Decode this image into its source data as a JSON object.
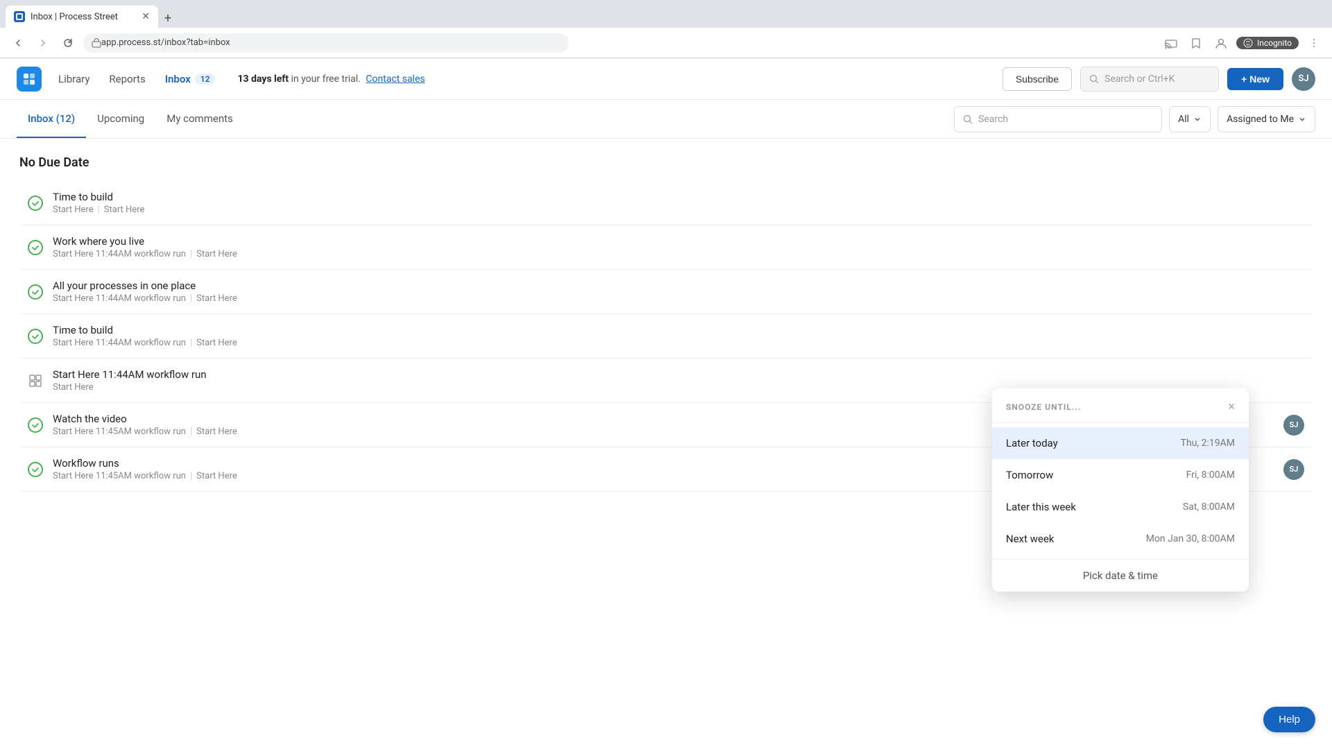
{
  "browser": {
    "tab_title": "Inbox | Process Street",
    "url": "app.process.st/inbox?tab=inbox",
    "new_tab_label": "+",
    "incognito_label": "Incognito"
  },
  "nav": {
    "library_label": "Library",
    "reports_label": "Reports",
    "inbox_label": "Inbox",
    "inbox_count": "12",
    "trial_text_bold": "13 days left",
    "trial_text_normal": " in your free trial.",
    "contact_sales_label": "Contact sales",
    "subscribe_label": "Subscribe",
    "search_placeholder": "Search or Ctrl+K",
    "new_label": "+ New",
    "avatar_initials": "SJ"
  },
  "sub_nav": {
    "tab_inbox_label": "Inbox (12)",
    "tab_upcoming_label": "Upcoming",
    "tab_comments_label": "My comments",
    "search_placeholder": "Search",
    "filter_label": "All",
    "assigned_label": "Assigned to Me"
  },
  "main": {
    "section_title": "No Due Date",
    "items": [
      {
        "title": "Time to build",
        "subtitle_part1": "Start Here",
        "subtitle_sep": "|",
        "subtitle_part2": "Start Here",
        "type": "check",
        "has_avatar": false
      },
      {
        "title": "Work where you live",
        "subtitle_part1": "Start Here 11:44AM workflow run",
        "subtitle_sep": "|",
        "subtitle_part2": "Start Here",
        "type": "check",
        "has_avatar": false
      },
      {
        "title": "All your processes in one place",
        "subtitle_part1": "Start Here 11:44AM workflow run",
        "subtitle_sep": "|",
        "subtitle_part2": "Start Here",
        "type": "check",
        "has_avatar": false
      },
      {
        "title": "Time to build",
        "subtitle_part1": "Start Here 11:44AM workflow run",
        "subtitle_sep": "|",
        "subtitle_part2": "Start Here",
        "type": "check",
        "has_avatar": false
      },
      {
        "title": "Start Here 11:44AM workflow run",
        "subtitle_part1": "Start Here",
        "subtitle_sep": "",
        "subtitle_part2": "",
        "type": "grid",
        "has_avatar": false
      },
      {
        "title": "Watch the video",
        "subtitle_part1": "Start Here 11:45AM workflow run",
        "subtitle_sep": "|",
        "subtitle_part2": "Start Here",
        "type": "check",
        "has_avatar": true
      },
      {
        "title": "Workflow runs",
        "subtitle_part1": "Start Here 11:45AM workflow run",
        "subtitle_sep": "|",
        "subtitle_part2": "Start Here",
        "type": "check",
        "has_avatar": true
      }
    ],
    "avatar_initials": "SJ"
  },
  "snooze": {
    "title": "SNOOZE UNTIL...",
    "close_symbol": "×",
    "items": [
      {
        "label": "Later today",
        "time": "Thu, 2:19AM",
        "hovered": true
      },
      {
        "label": "Tomorrow",
        "time": "Fri, 8:00AM",
        "hovered": false
      },
      {
        "label": "Later this week",
        "time": "Sat, 8:00AM",
        "hovered": false
      },
      {
        "label": "Next week",
        "time": "Mon Jan 30, 8:00AM",
        "hovered": false
      }
    ],
    "pick_label": "Pick date & time"
  },
  "help": {
    "label": "Help"
  }
}
